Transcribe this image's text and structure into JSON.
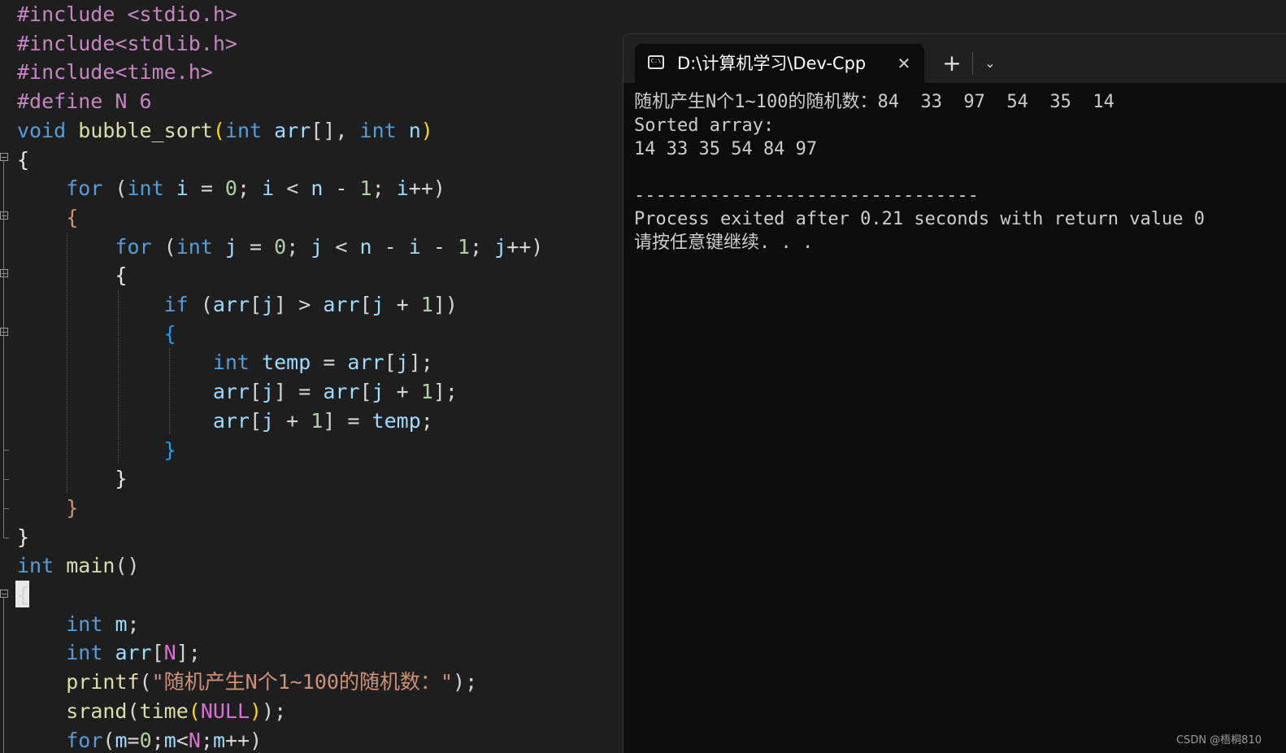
{
  "editor": {
    "lines": [
      [
        {
          "t": "#include <stdio.h>",
          "c": "pre"
        }
      ],
      [
        {
          "t": "#include<stdlib.h>",
          "c": "pre"
        }
      ],
      [
        {
          "t": "#include<time.h>",
          "c": "pre"
        }
      ],
      [
        {
          "t": "#define N 6",
          "c": "pre"
        }
      ],
      [
        {
          "t": "void",
          "c": "kw"
        },
        {
          "t": " ",
          "c": "op"
        },
        {
          "t": "bubble_sort",
          "c": "fn"
        },
        {
          "t": "(",
          "c": "br1"
        },
        {
          "t": "int",
          "c": "kw"
        },
        {
          "t": " ",
          "c": "op"
        },
        {
          "t": "arr",
          "c": "id"
        },
        {
          "t": "[], ",
          "c": "op"
        },
        {
          "t": "int",
          "c": "kw"
        },
        {
          "t": " ",
          "c": "op"
        },
        {
          "t": "n",
          "c": "id"
        },
        {
          "t": ")",
          "c": "br1"
        }
      ],
      [
        {
          "t": "{",
          "c": "brw"
        }
      ],
      [
        {
          "t": "    ",
          "c": "op"
        },
        {
          "t": "for",
          "c": "kw"
        },
        {
          "t": " (",
          "c": "op"
        },
        {
          "t": "int",
          "c": "kw"
        },
        {
          "t": " ",
          "c": "op"
        },
        {
          "t": "i",
          "c": "id"
        },
        {
          "t": " = ",
          "c": "op"
        },
        {
          "t": "0",
          "c": "num"
        },
        {
          "t": "; ",
          "c": "op"
        },
        {
          "t": "i",
          "c": "id"
        },
        {
          "t": " < ",
          "c": "op"
        },
        {
          "t": "n",
          "c": "id"
        },
        {
          "t": " - ",
          "c": "op"
        },
        {
          "t": "1",
          "c": "num"
        },
        {
          "t": "; ",
          "c": "op"
        },
        {
          "t": "i",
          "c": "id"
        },
        {
          "t": "++)",
          "c": "op"
        }
      ],
      [
        {
          "t": "    ",
          "c": "op"
        },
        {
          "t": "{",
          "c": "str"
        }
      ],
      [
        {
          "t": "        ",
          "c": "op"
        },
        {
          "t": "for",
          "c": "kw"
        },
        {
          "t": " (",
          "c": "op"
        },
        {
          "t": "int",
          "c": "kw"
        },
        {
          "t": " ",
          "c": "op"
        },
        {
          "t": "j",
          "c": "id"
        },
        {
          "t": " = ",
          "c": "op"
        },
        {
          "t": "0",
          "c": "num"
        },
        {
          "t": "; ",
          "c": "op"
        },
        {
          "t": "j",
          "c": "id"
        },
        {
          "t": " < ",
          "c": "op"
        },
        {
          "t": "n",
          "c": "id"
        },
        {
          "t": " - ",
          "c": "op"
        },
        {
          "t": "i",
          "c": "id"
        },
        {
          "t": " - ",
          "c": "op"
        },
        {
          "t": "1",
          "c": "num"
        },
        {
          "t": "; ",
          "c": "op"
        },
        {
          "t": "j",
          "c": "id"
        },
        {
          "t": "++)",
          "c": "op"
        }
      ],
      [
        {
          "t": "        ",
          "c": "op"
        },
        {
          "t": "{",
          "c": "brw"
        }
      ],
      [
        {
          "t": "            ",
          "c": "op"
        },
        {
          "t": "if",
          "c": "kw"
        },
        {
          "t": " (",
          "c": "op"
        },
        {
          "t": "arr",
          "c": "id"
        },
        {
          "t": "[",
          "c": "op"
        },
        {
          "t": "j",
          "c": "id"
        },
        {
          "t": "] > ",
          "c": "op"
        },
        {
          "t": "arr",
          "c": "id"
        },
        {
          "t": "[",
          "c": "op"
        },
        {
          "t": "j",
          "c": "id"
        },
        {
          "t": " + ",
          "c": "op"
        },
        {
          "t": "1",
          "c": "num"
        },
        {
          "t": "])",
          "c": "op"
        }
      ],
      [
        {
          "t": "            ",
          "c": "op"
        },
        {
          "t": "{",
          "c": "br3"
        }
      ],
      [
        {
          "t": "                ",
          "c": "op"
        },
        {
          "t": "int",
          "c": "kw"
        },
        {
          "t": " ",
          "c": "op"
        },
        {
          "t": "temp",
          "c": "id"
        },
        {
          "t": " = ",
          "c": "op"
        },
        {
          "t": "arr",
          "c": "id"
        },
        {
          "t": "[",
          "c": "op"
        },
        {
          "t": "j",
          "c": "id"
        },
        {
          "t": "];",
          "c": "op"
        }
      ],
      [
        {
          "t": "                ",
          "c": "op"
        },
        {
          "t": "arr",
          "c": "id"
        },
        {
          "t": "[",
          "c": "op"
        },
        {
          "t": "j",
          "c": "id"
        },
        {
          "t": "] = ",
          "c": "op"
        },
        {
          "t": "arr",
          "c": "id"
        },
        {
          "t": "[",
          "c": "op"
        },
        {
          "t": "j",
          "c": "id"
        },
        {
          "t": " + ",
          "c": "op"
        },
        {
          "t": "1",
          "c": "num"
        },
        {
          "t": "];",
          "c": "op"
        }
      ],
      [
        {
          "t": "                ",
          "c": "op"
        },
        {
          "t": "arr",
          "c": "id"
        },
        {
          "t": "[",
          "c": "op"
        },
        {
          "t": "j",
          "c": "id"
        },
        {
          "t": " + ",
          "c": "op"
        },
        {
          "t": "1",
          "c": "num"
        },
        {
          "t": "] = ",
          "c": "op"
        },
        {
          "t": "temp",
          "c": "id"
        },
        {
          "t": ";",
          "c": "op"
        }
      ],
      [
        {
          "t": "            ",
          "c": "op"
        },
        {
          "t": "}",
          "c": "br3"
        }
      ],
      [
        {
          "t": "        ",
          "c": "op"
        },
        {
          "t": "}",
          "c": "brw"
        }
      ],
      [
        {
          "t": "    ",
          "c": "op"
        },
        {
          "t": "}",
          "c": "str"
        }
      ],
      [
        {
          "t": "}",
          "c": "brw"
        }
      ],
      [
        {
          "t": "int",
          "c": "kw"
        },
        {
          "t": " ",
          "c": "op"
        },
        {
          "t": "main",
          "c": "fn"
        },
        {
          "t": "()",
          "c": "op"
        }
      ],
      [
        {
          "t": "{",
          "c": "op"
        }
      ],
      [
        {
          "t": "    ",
          "c": "op"
        },
        {
          "t": "int",
          "c": "kw"
        },
        {
          "t": " ",
          "c": "op"
        },
        {
          "t": "m",
          "c": "id"
        },
        {
          "t": ";",
          "c": "op"
        }
      ],
      [
        {
          "t": "    ",
          "c": "op"
        },
        {
          "t": "int",
          "c": "kw"
        },
        {
          "t": " ",
          "c": "op"
        },
        {
          "t": "arr",
          "c": "id"
        },
        {
          "t": "[",
          "c": "op"
        },
        {
          "t": "N",
          "c": "br2"
        },
        {
          "t": "];",
          "c": "op"
        }
      ],
      [
        {
          "t": "    ",
          "c": "op"
        },
        {
          "t": "printf",
          "c": "fn"
        },
        {
          "t": "(",
          "c": "op"
        },
        {
          "t": "\"随机产生N个1~100的随机数：\"",
          "c": "str"
        },
        {
          "t": ");",
          "c": "op"
        }
      ],
      [
        {
          "t": "    ",
          "c": "op"
        },
        {
          "t": "srand",
          "c": "fn"
        },
        {
          "t": "(",
          "c": "op"
        },
        {
          "t": "time",
          "c": "fn"
        },
        {
          "t": "(",
          "c": "br1"
        },
        {
          "t": "NULL",
          "c": "br2"
        },
        {
          "t": ")",
          "c": "br1"
        },
        {
          "t": ");",
          "c": "op"
        }
      ],
      [
        {
          "t": "    ",
          "c": "op"
        },
        {
          "t": "for",
          "c": "kw"
        },
        {
          "t": "(",
          "c": "op"
        },
        {
          "t": "m",
          "c": "id"
        },
        {
          "t": "=",
          "c": "op"
        },
        {
          "t": "0",
          "c": "num"
        },
        {
          "t": ";",
          "c": "op"
        },
        {
          "t": "m",
          "c": "id"
        },
        {
          "t": "<",
          "c": "op"
        },
        {
          "t": "N",
          "c": "br2"
        },
        {
          "t": ";",
          "c": "op"
        },
        {
          "t": "m",
          "c": "id"
        },
        {
          "t": "++)",
          "c": "op"
        }
      ]
    ]
  },
  "terminal": {
    "tab_icon_text": "C:\\",
    "tab_title": "D:\\计算机学习\\Dev-Cpp",
    "close_glyph": "✕",
    "new_tab_glyph": "+",
    "dropdown_glyph": "⌄",
    "output_lines": [
      "随机产生N个1~100的随机数：84  33  97  54  35  14",
      "Sorted array:",
      "14 33 35 54 84 97",
      "",
      "--------------------------------",
      "Process exited after 0.21 seconds with return value 0",
      "请按任意键继续. . ."
    ]
  },
  "watermark": "CSDN @梧桐810"
}
